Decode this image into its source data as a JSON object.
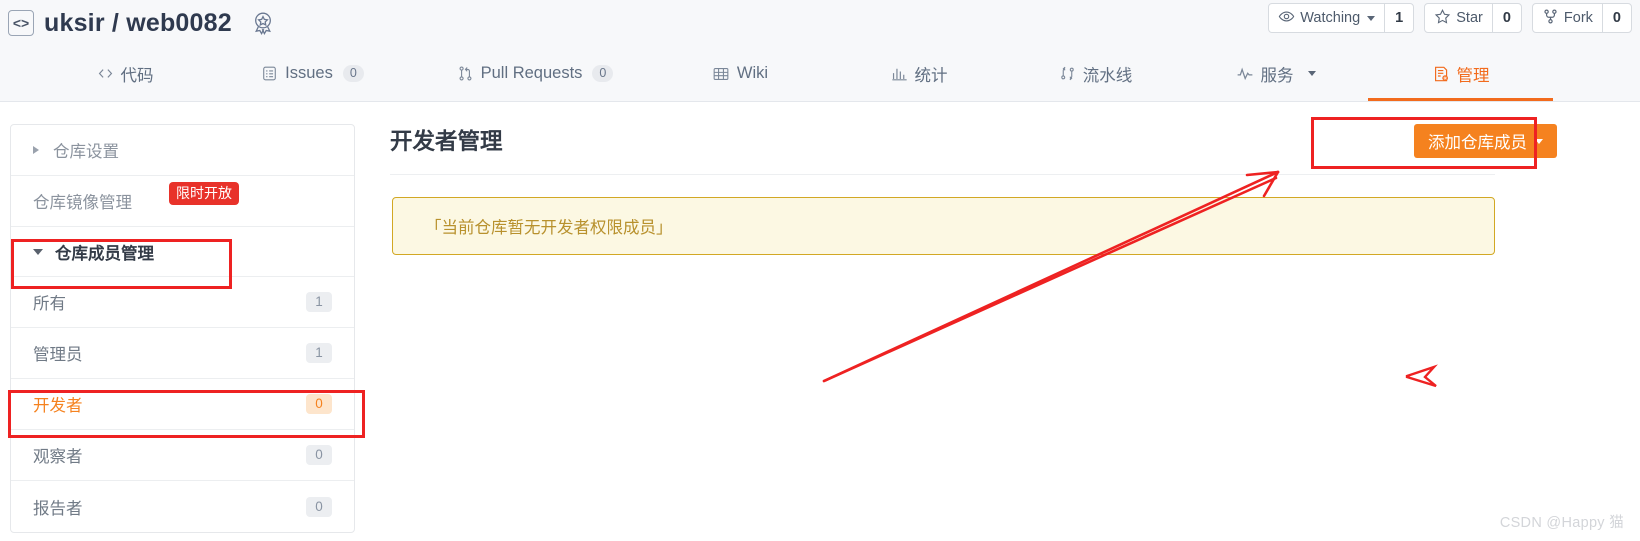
{
  "header": {
    "code_icon": "code-brackets-icon",
    "owner": "uksir",
    "separator": "/",
    "repo": "web0082",
    "title": "uksir / web0082",
    "badge_icon": "award-rosette-icon",
    "actions": [
      {
        "icon": "eye-icon",
        "label": "Watching",
        "has_caret": true,
        "count": "1"
      },
      {
        "icon": "star-icon",
        "label": "Star",
        "has_caret": false,
        "count": "0"
      },
      {
        "icon": "fork-icon",
        "label": "Fork",
        "has_caret": false,
        "count": "0"
      }
    ]
  },
  "nav": {
    "items": [
      {
        "icon": "code-tag-icon",
        "label": "代码",
        "badge": null,
        "active": false,
        "caret": false
      },
      {
        "icon": "issue-list-icon",
        "label": "Issues",
        "badge": "0",
        "active": false,
        "caret": false
      },
      {
        "icon": "pull-request-icon",
        "label": "Pull Requests",
        "badge": "0",
        "active": false,
        "caret": false
      },
      {
        "icon": "book-icon",
        "label": "Wiki",
        "badge": null,
        "active": false,
        "caret": false
      },
      {
        "icon": "bar-chart-icon",
        "label": "统计",
        "badge": null,
        "active": false,
        "caret": false
      },
      {
        "icon": "pipeline-icon",
        "label": "流水线",
        "badge": null,
        "active": false,
        "caret": false
      },
      {
        "icon": "pulse-icon",
        "label": "服务",
        "badge": null,
        "active": false,
        "caret": true
      },
      {
        "icon": "manage-doc-icon",
        "label": "管理",
        "badge": null,
        "active": true,
        "caret": false
      }
    ]
  },
  "sidebar": {
    "groups": [
      {
        "label": "仓库设置",
        "state": "collapsed",
        "badge": null
      },
      {
        "label": "仓库镜像管理",
        "state": "plain",
        "badge": "限时开放"
      },
      {
        "label": "仓库成员管理",
        "state": "expanded",
        "badge": null
      }
    ],
    "members": [
      {
        "label": "所有",
        "count": "1",
        "selected": false
      },
      {
        "label": "管理员",
        "count": "1",
        "selected": false
      },
      {
        "label": "开发者",
        "count": "0",
        "selected": true
      },
      {
        "label": "观察者",
        "count": "0",
        "selected": false
      },
      {
        "label": "报告者",
        "count": "0",
        "selected": false
      }
    ]
  },
  "main": {
    "page_title": "开发者管理",
    "add_member_button": "添加仓库成员",
    "add_member_caret_icon": "caret-down-icon",
    "alert_message": "「当前仓库暂无开发者权限成员」"
  },
  "annotations": {
    "box_members_label": "red-highlight-box-repo-members",
    "box_developer_label": "red-highlight-box-developer",
    "box_addbutton_label": "red-highlight-box-add-member",
    "arrow_label": "red-arrow-pointing-to-add-member",
    "pointer_label": "red-arrowhead-marker"
  },
  "colors": {
    "accent_orange": "#f5821f",
    "annotation_red": "#ee2222",
    "alert_bg": "#fcf8e3",
    "alert_border": "#d2a824",
    "badge_red": "#e8322a",
    "header_bg": "#f7f8fa"
  },
  "watermark": "CSDN @Happy 猫"
}
